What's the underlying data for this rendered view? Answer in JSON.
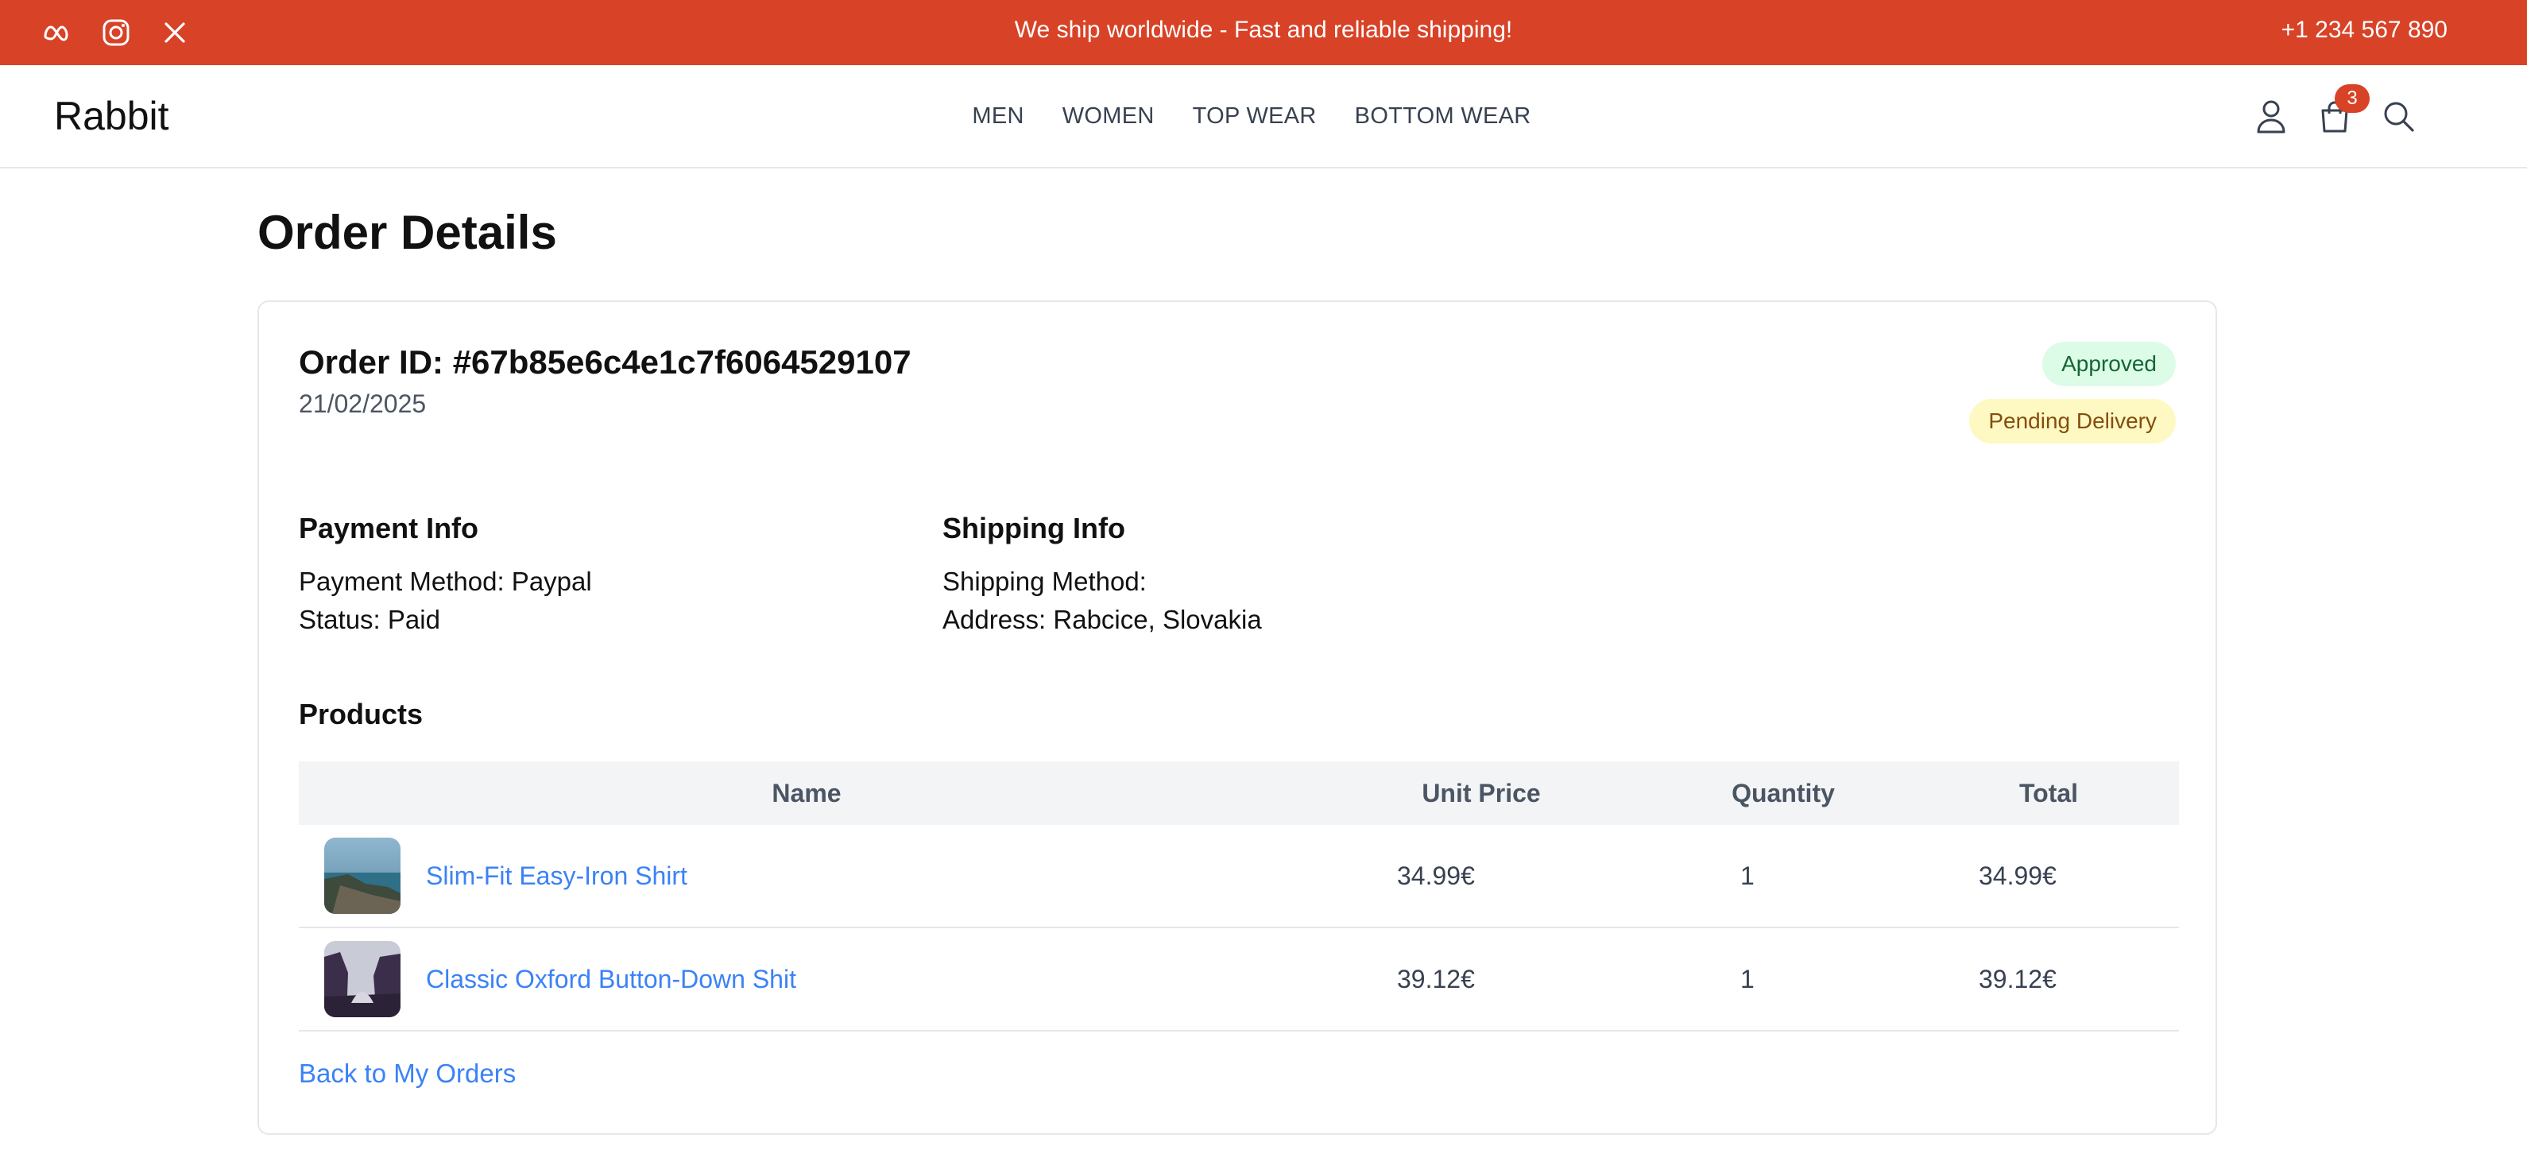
{
  "topbar": {
    "socials": [
      "meta-icon",
      "instagram-icon",
      "x-icon"
    ],
    "announcement": "We ship worldwide - Fast and reliable shipping!",
    "phone": "+1 234 567 890",
    "bg_color": "#d84227"
  },
  "navbar": {
    "logo": "Rabbit",
    "links": [
      "MEN",
      "WOMEN",
      "TOP WEAR",
      "BOTTOM WEAR"
    ],
    "icons": [
      "user-icon",
      "shopping-bag-icon",
      "search-icon"
    ],
    "cart_count": "3"
  },
  "page": {
    "title": "Order Details"
  },
  "order": {
    "id_label": "Order ID: #67b85e6c4e1c7f6064529107",
    "date": "21/02/2025",
    "status_approved": "Approved",
    "status_delivery": "Pending Delivery",
    "payment": {
      "heading": "Payment Info",
      "method": "Payment Method: Paypal",
      "status": "Status: Paid"
    },
    "shipping": {
      "heading": "Shipping Info",
      "method": "Shipping Method:",
      "address": "Address: Rabcice, Slovakia"
    },
    "products_heading": "Products",
    "columns": [
      "Name",
      "Unit Price",
      "Quantity",
      "Total"
    ],
    "items": [
      {
        "name": "Slim-Fit Easy-Iron Shirt",
        "unit_price": "34.99€",
        "quantity": "1",
        "total": "34.99€"
      },
      {
        "name": "Classic Oxford Button-Down Shit",
        "unit_price": "39.12€",
        "quantity": "1",
        "total": "39.12€"
      }
    ],
    "back_link": "Back to My Orders"
  },
  "colors": {
    "accent": "#d84227",
    "link": "#3b82f6",
    "approved_bg": "#dcfce7",
    "pending_bg": "#fef9c3"
  }
}
